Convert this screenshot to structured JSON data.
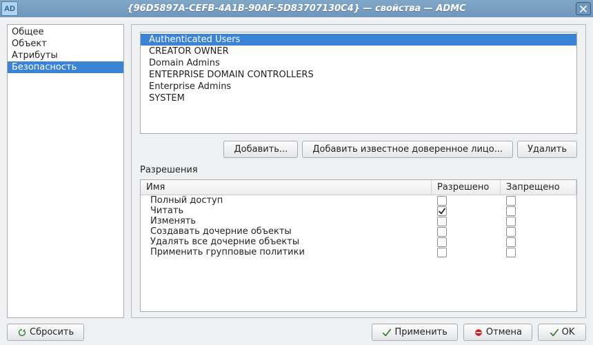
{
  "titlebar": {
    "app_icon_label": "AD",
    "title": "{96D5897A-CEFB-4A1B-90AF-5D83707130C4} — свойства — ADMC"
  },
  "nav": {
    "items": [
      {
        "label": "Общее",
        "selected": false
      },
      {
        "label": "Объект",
        "selected": false
      },
      {
        "label": "Атрибуты",
        "selected": false
      },
      {
        "label": "Безопасность",
        "selected": true
      }
    ]
  },
  "principals": {
    "items": [
      {
        "label": "Authenticated Users",
        "selected": true
      },
      {
        "label": "CREATOR OWNER",
        "selected": false
      },
      {
        "label": "Domain Admins",
        "selected": false
      },
      {
        "label": "ENTERPRISE DOMAIN CONTROLLERS",
        "selected": false
      },
      {
        "label": "Enterprise Admins",
        "selected": false
      },
      {
        "label": "SYSTEM",
        "selected": false
      }
    ]
  },
  "principal_buttons": {
    "add": "Добавить...",
    "add_known": "Добавить известное доверенное лицо...",
    "delete": "Удалить"
  },
  "permissions": {
    "section_label": "Разрешения",
    "columns": {
      "name": "Имя",
      "allow": "Разрешено",
      "deny": "Запрещено"
    },
    "rows": [
      {
        "label": "Полный доступ",
        "allow": false,
        "deny": false
      },
      {
        "label": "Читать",
        "allow": true,
        "deny": false
      },
      {
        "label": "Изменять",
        "allow": false,
        "deny": false
      },
      {
        "label": "Создавать дочерние объекты",
        "allow": false,
        "deny": false
      },
      {
        "label": "Удалять все дочерние объекты",
        "allow": false,
        "deny": false
      },
      {
        "label": "Применить групповые политики",
        "allow": false,
        "deny": false
      }
    ]
  },
  "bottom_buttons": {
    "reset": "Сбросить",
    "apply": "Применить",
    "cancel": "Отмена",
    "ok": "OK"
  }
}
